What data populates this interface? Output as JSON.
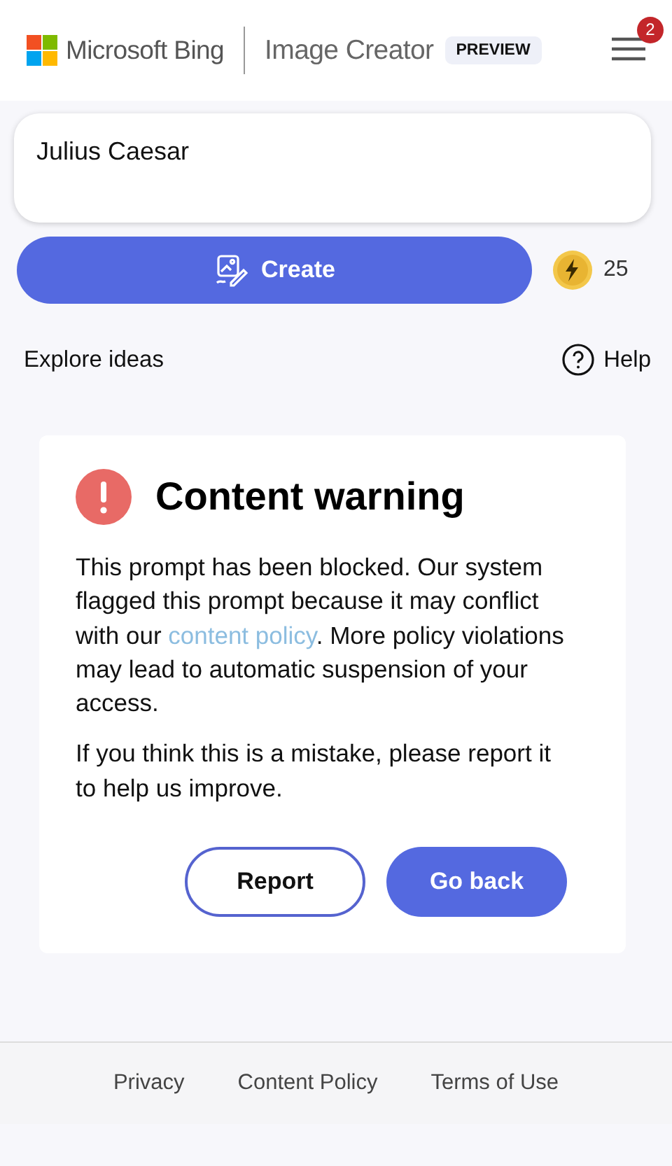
{
  "header": {
    "brand": "Microsoft Bing",
    "product": "Image Creator",
    "badge": "PREVIEW",
    "notification_count": "2"
  },
  "prompt": {
    "value": "Julius Caesar"
  },
  "create_button": {
    "label": "Create"
  },
  "boosts": {
    "count": "25"
  },
  "links": {
    "explore": "Explore ideas",
    "help": "Help"
  },
  "warning": {
    "title": "Content warning",
    "message_before": "This prompt has been blocked. Our system flagged this prompt because it may conflict with our ",
    "link": "content policy",
    "message_after": ". More policy violations may lead to automatic suspension of your access.",
    "note": "If you think this is a mistake, please report it to help us improve.",
    "buttons": [
      {
        "label": "Report",
        "kind": "outline"
      },
      {
        "label": "Go back",
        "kind": "primary"
      }
    ]
  },
  "footer": [
    "Privacy",
    "Content Policy",
    "Terms of Use"
  ]
}
